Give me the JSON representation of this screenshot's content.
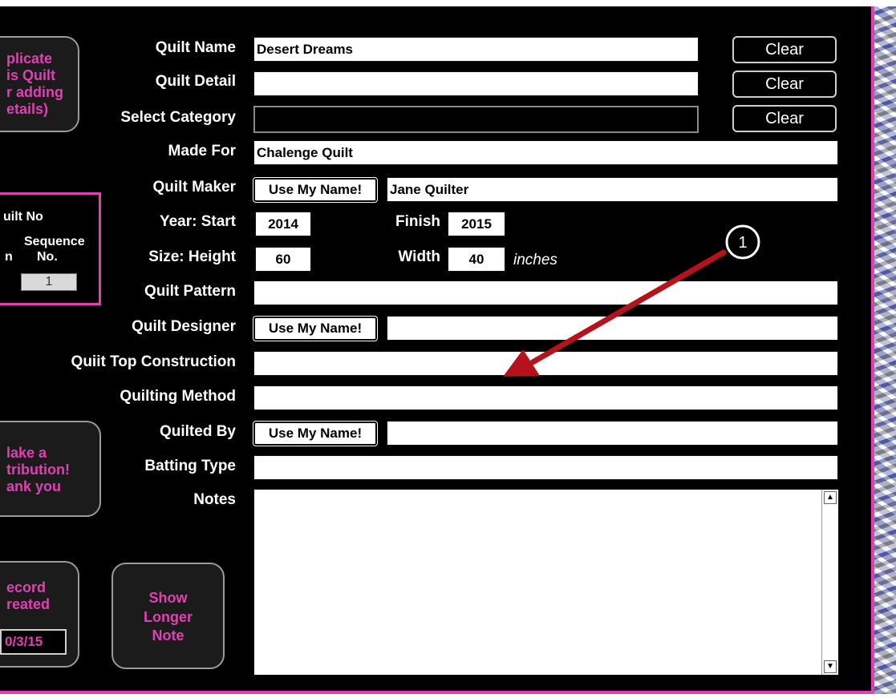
{
  "labels": {
    "quilt_name": "Quilt Name",
    "quilt_detail": "Quilt Detail",
    "select_category": "Select Category",
    "made_for": "Made For",
    "quilt_maker": "Quilt Maker",
    "year_start": "Year: Start",
    "finish": "Finish",
    "size_height": "Size: Height",
    "width": "Width",
    "inches": "inches",
    "quilt_pattern": "Quilt Pattern",
    "quilt_designer": "Quilt Designer",
    "top_construction": "Quiit Top Construction",
    "quilting_method": "Quilting Method",
    "quilted_by": "Quilted By",
    "batting_type": "Batting Type",
    "notes": "Notes"
  },
  "values": {
    "quilt_name": "Desert Dreams",
    "quilt_detail": "",
    "select_category": "",
    "made_for": "Chalenge Quilt",
    "quilt_maker": "Jane Quilter",
    "year_start": "2014",
    "finish": "2015",
    "height": "60",
    "width": "40",
    "quilt_pattern": "",
    "quilt_designer": "",
    "top_construction": "",
    "quilting_method": "",
    "quilted_by": "",
    "batting_type": "",
    "notes": ""
  },
  "buttons": {
    "clear": "Clear",
    "use_my_name": "Use My Name!",
    "duplicate": [
      "plicate",
      "is Quilt",
      "r adding",
      "etails)"
    ],
    "contribution": [
      "lake a",
      "tribution!",
      "ank you"
    ],
    "record_created": [
      "ecord",
      "reated"
    ],
    "show_longer_note": [
      "Show",
      "Longer",
      "Note"
    ]
  },
  "sidebar": {
    "quilt_no": "uilt No",
    "sequence_1": "Sequence",
    "sequence_2": "No.",
    "sequence_left": "n",
    "sequence_value": "1",
    "record_date": "0/3/15"
  },
  "annotation": {
    "step": "1"
  },
  "colors": {
    "accent_pink": "#e23fb4",
    "background": "#000000",
    "arrow_red": "#b5121b"
  },
  "icons": {
    "scroll_up": "▲",
    "scroll_down": "▼"
  }
}
